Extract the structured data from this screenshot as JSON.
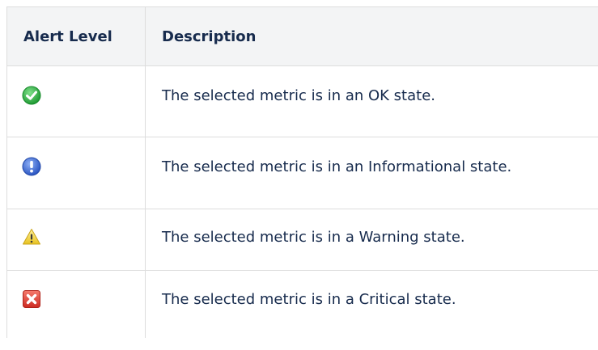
{
  "table": {
    "headers": {
      "level": "Alert Level",
      "description": "Description"
    },
    "rows": [
      {
        "icon": "ok-checkmark-icon",
        "description": "The selected metric is in an OK state."
      },
      {
        "icon": "informational-exclamation-icon",
        "description": "The selected metric is in an Informational state."
      },
      {
        "icon": "warning-triangle-icon",
        "description": "The selected metric is in a Warning state."
      },
      {
        "icon": "critical-x-icon",
        "description": "The selected metric is in a Critical state."
      }
    ]
  },
  "colors": {
    "ok_green": "#3cb54a",
    "info_blue": "#3f6fd8",
    "warning_yellow": "#f2d23a",
    "critical_red": "#e2483c",
    "header_bg": "#f3f4f5",
    "border": "#dddddd",
    "text": "#172b4d"
  }
}
